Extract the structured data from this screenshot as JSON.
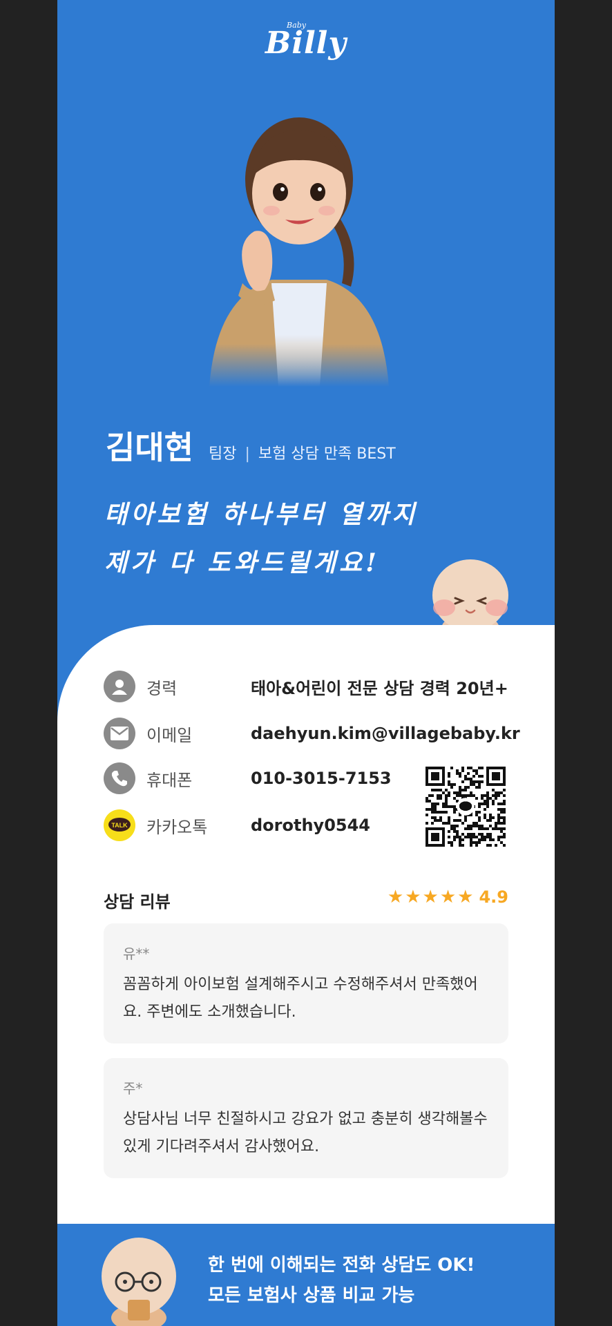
{
  "brand": {
    "logo_small": "Baby",
    "logo_main": "Billy"
  },
  "profile": {
    "name": "김대현",
    "role": "팀장",
    "divider": "|",
    "badge": "보험 상담 만족 BEST",
    "slogan_line1": "태아보험 하나부터 열까지",
    "slogan_line2": "제가 다 도와드릴게요!"
  },
  "contact": {
    "career_label": "경력",
    "career_value": "태아&어린이 전문 상담 경력 20년+",
    "email_label": "이메일",
    "email_value": "daehyun.kim@villagebaby.kr",
    "phone_label": "휴대폰",
    "phone_value": "010-3015-7153",
    "kakao_label": "카카오톡",
    "kakao_value": "dorothy0544",
    "kakao_icon_text": "TALK"
  },
  "reviews": {
    "title": "상담 리뷰",
    "rating": "4.9",
    "star_count": 5,
    "items": [
      {
        "author": "유**",
        "text": "꼼꼼하게 아이보험 설계해주시고 수정해주셔서 만족했어요. 주변에도 소개했습니다."
      },
      {
        "author": "주*",
        "text": "상담사님 너무 친절하시고 강요가 없고 충분히 생각해볼수 있게 기다려주셔서 감사했어요."
      }
    ]
  },
  "footer": {
    "line1": "한 번에 이해되는 전화 상담도 OK!",
    "line2": "모든 보험사 상품 비교 가능"
  },
  "colors": {
    "primary": "#2F7BD2",
    "star": "#F7A823",
    "kakao": "#F7DE1A"
  },
  "icons": [
    "person-icon",
    "mail-icon",
    "phone-icon",
    "kakao-talk-icon",
    "star-icon",
    "qr-code"
  ]
}
